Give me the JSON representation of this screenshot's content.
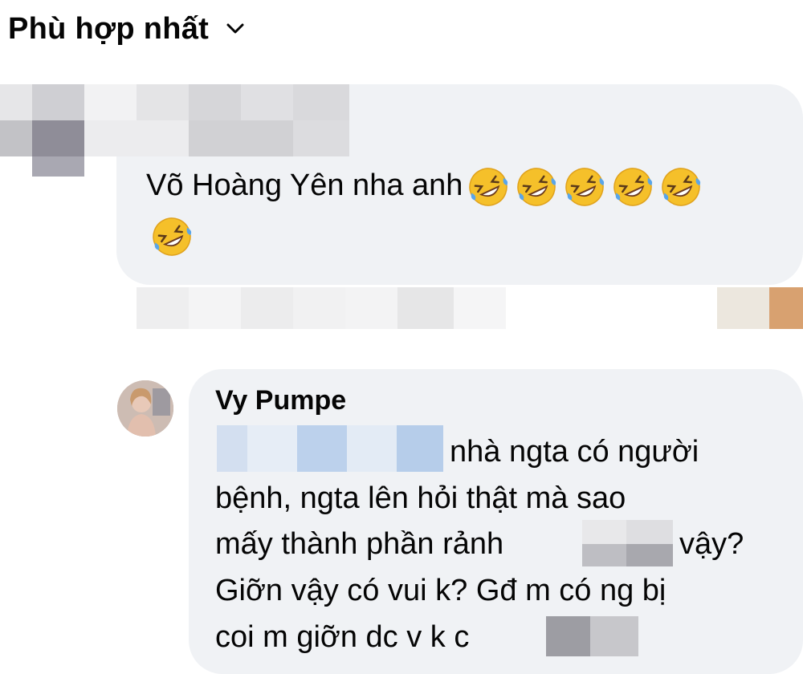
{
  "sort": {
    "label": "Phù hợp nhất"
  },
  "comment": {
    "text": "Võ Hoàng Yên nha anh",
    "emoji_name": "rolling-on-floor-laughing-emoji",
    "emoji_count": 6
  },
  "reply": {
    "author": "Vy Pumpe",
    "lines": [
      "nhà ngta có người",
      "bệnh, ngta lên hỏi thật mà sao",
      "mấy thành phần rảnh",
      "vậy?",
      "Giỡn vậy có vui k? Gđ m có ng bị",
      "coi m giỡn dc v k c"
    ]
  },
  "colors": {
    "bubble": "#f0f2f5",
    "text": "#050505",
    "emoji_face": "#f5c02a",
    "tear": "#5aa5e8"
  }
}
